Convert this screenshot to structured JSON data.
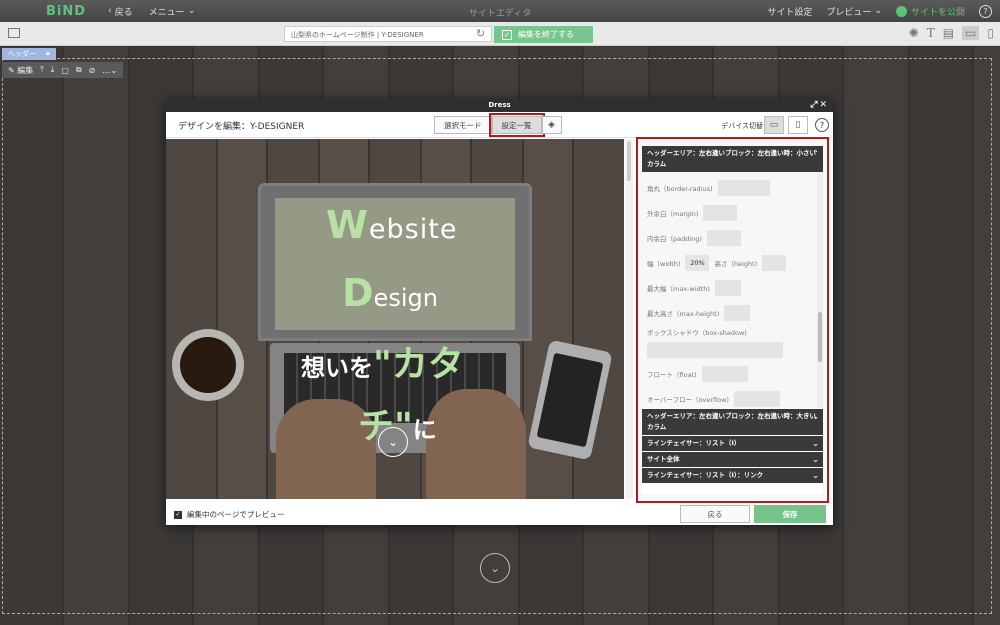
{
  "topbar": {
    "logo": "BiND",
    "back": "戻る",
    "menu": "メニュー",
    "title": "サイトエディタ",
    "site_settings": "サイト設定",
    "preview": "プレビュー",
    "publish": "サイトを公開",
    "help": "?"
  },
  "bar2": {
    "url": "山梨県のホームページ制作 | Y-DESIGNER",
    "end_edit": "編集を終了する"
  },
  "editor": {
    "header_tag": "ヘッダー",
    "edit_label": "編集"
  },
  "modal": {
    "window_title": "Dress",
    "heading": "デザインを編集：Y-DESIGNER",
    "mode_select": "選択モード",
    "mode_list": "設定一覧",
    "device_switch": "デバイス切替",
    "hero": {
      "web_initial": "W",
      "web_rest": "ebsite",
      "des_initial": "D",
      "des_rest": "esign",
      "jp_a": "想いを",
      "jp_b": "\"カタ",
      "jp_c": "チ\"",
      "jp_d": "に"
    },
    "preview_check": "編集中のページでプレビュー",
    "back": "戻る",
    "save": "保存"
  },
  "panel": {
    "active_section": "ヘッダーエリア：左右違いブロック：左右違い時：小さいカラム",
    "fields": [
      {
        "label": "角丸（border-radius)",
        "value": ""
      },
      {
        "label": "外余白（margin)",
        "value": ""
      },
      {
        "label": "内余白（padding)",
        "value": ""
      },
      {
        "label": "幅（width)",
        "value": "20%",
        "label2": "高さ（height)"
      },
      {
        "label": "最大幅（max-width)",
        "value": ""
      },
      {
        "label": "最大高さ（max-height)",
        "value": ""
      },
      {
        "label": "ボックスシャドウ（box-shadow)",
        "value": ""
      },
      {
        "label": "フロート（float)",
        "value": ""
      },
      {
        "label": "オーバーフロー（overflow)",
        "value": ""
      }
    ],
    "sections": [
      "ヘッダーエリア：左右違いブロック：左右違い時：大きいカラム",
      "ラインチェイサー：リスト（I）",
      "サイト全体",
      "ラインチェイサー：リスト（I）：リンク"
    ]
  }
}
